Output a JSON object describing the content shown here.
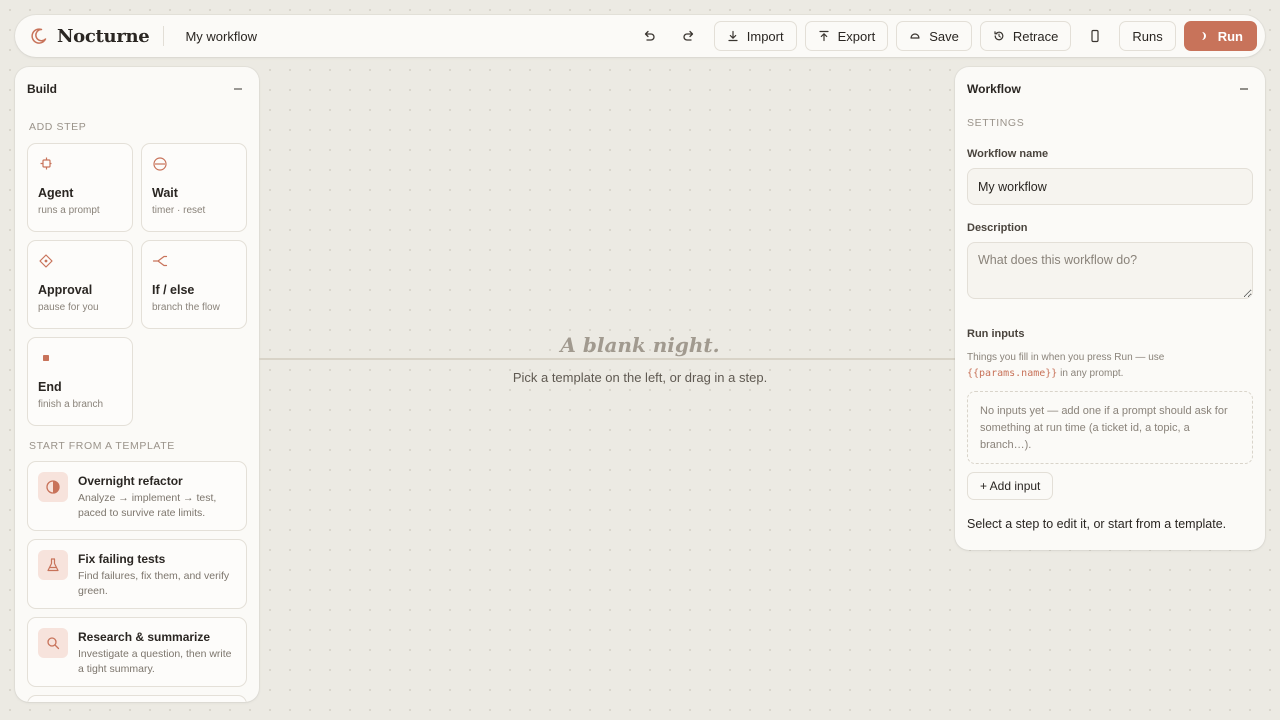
{
  "app": {
    "brand_name": "Nocturne",
    "workflow_title": "My workflow"
  },
  "colors": {
    "accent": "#c8735a",
    "background": "#eceae3",
    "panel": "#fbfaf7"
  },
  "toolbar": {
    "undo_icon": "undo-icon",
    "redo_icon": "redo-icon",
    "import_label": "Import",
    "export_label": "Export",
    "save_label": "Save",
    "retrace_label": "Retrace",
    "device_icon": "phone-icon",
    "runs_label": "Runs",
    "run_label": "Run"
  },
  "build_panel": {
    "title": "Build",
    "add_step_label": "ADD STEP",
    "steps": [
      {
        "name": "Agent",
        "desc": "runs a prompt",
        "icon": "agent-icon"
      },
      {
        "name": "Wait",
        "desc": "timer · reset",
        "icon": "wait-icon"
      },
      {
        "name": "Approval",
        "desc": "pause for you",
        "icon": "approval-icon"
      },
      {
        "name": "If / else",
        "desc": "branch the flow",
        "icon": "branch-icon"
      },
      {
        "name": "End",
        "desc": "finish a branch",
        "icon": "stop-icon"
      }
    ],
    "template_label": "START FROM A TEMPLATE",
    "templates": [
      {
        "name": "Overnight refactor",
        "desc": "Analyze → implement → test, paced to survive rate limits.",
        "icon": "half-moon-icon"
      },
      {
        "name": "Fix failing tests",
        "desc": "Find failures, fix them, and verify green.",
        "icon": "flask-icon"
      },
      {
        "name": "Research & summarize",
        "desc": "Investigate a question, then write a tight summary.",
        "icon": "search-icon"
      }
    ]
  },
  "canvas": {
    "title": "A blank night.",
    "subtitle": "Pick a template on the left, or drag in a step."
  },
  "workflow_panel": {
    "title": "Workflow",
    "settings_label": "SETTINGS",
    "name_label": "Workflow name",
    "name_value": "My workflow",
    "description_label": "Description",
    "description_placeholder": "What does this workflow do?",
    "run_inputs_label": "Run inputs",
    "run_inputs_hint_pre": "Things you fill in when you press Run — use",
    "run_inputs_hint_code": "{{params.name}}",
    "run_inputs_hint_post": "in any prompt.",
    "empty_inputs": "No inputs yet — add one if a prompt should ask for something at run time (a ticket id, a topic, a branch…).",
    "add_input_label": "+ Add input",
    "footer": "Select a step to edit it, or start from a template."
  }
}
